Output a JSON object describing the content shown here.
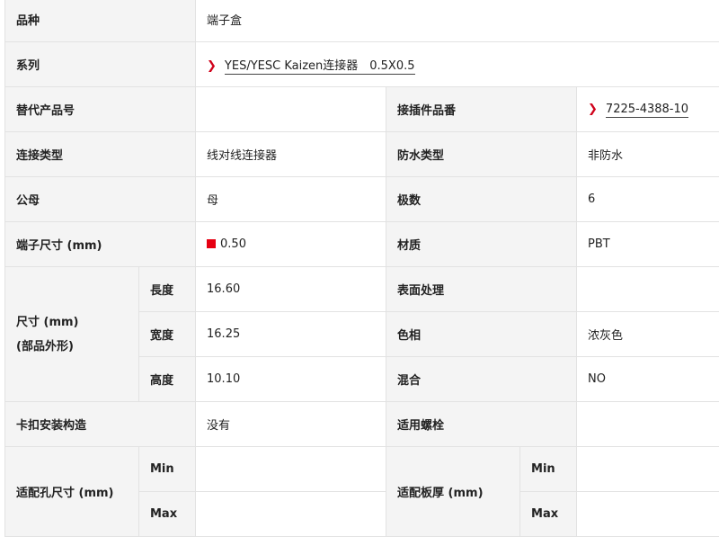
{
  "rows": {
    "variety": {
      "label": "品种",
      "value": "端子盒"
    },
    "series": {
      "label": "系列",
      "value": "YES/YESC Kaizen连接器　0.5X0.5"
    },
    "alt_part": {
      "label": "替代产品号",
      "value": ""
    },
    "mating_part": {
      "label": "接插件品番",
      "value": "7225-4388-10"
    },
    "connection_type": {
      "label": "连接类型",
      "value": "线对线连接器"
    },
    "waterproof_type": {
      "label": "防水类型",
      "value": "非防水"
    },
    "gender": {
      "label": "公母",
      "value": "母"
    },
    "poles": {
      "label": "极数",
      "value": "6"
    },
    "terminal_size": {
      "label": "端子尺寸 (mm)",
      "value": "0.50",
      "swatch_color": "#e60012"
    },
    "material": {
      "label": "材质",
      "value": "PBT"
    },
    "dimensions": {
      "label_line1": "尺寸 (mm)",
      "label_line2": "(部品外形)",
      "length": {
        "label": "長度",
        "value": "16.60"
      },
      "width": {
        "label": "宽度",
        "value": "16.25"
      },
      "height": {
        "label": "高度",
        "value": "10.10"
      }
    },
    "surface_treatment": {
      "label": "表面处理",
      "value": ""
    },
    "color": {
      "label": "色相",
      "value": "浓灰色"
    },
    "mixed": {
      "label": "混合",
      "value": "NO"
    },
    "clip_mount": {
      "label": "卡扣安装构造",
      "value": "没有"
    },
    "applicable_bolt": {
      "label": "适用螺栓",
      "value": ""
    },
    "hole_size": {
      "label": "适配孔尺寸 (mm)",
      "min_label": "Min",
      "max_label": "Max",
      "min_value": "",
      "max_value": ""
    },
    "panel_thickness": {
      "label": "适配板厚 (mm)",
      "min_label": "Min",
      "max_label": "Max",
      "min_value": "",
      "max_value": ""
    }
  },
  "colors": {
    "accent": "#d0021b",
    "label_bg": "#f4f4f4",
    "border": "#e2e2e2"
  },
  "icons": {
    "link": "chevron-right-icon"
  }
}
